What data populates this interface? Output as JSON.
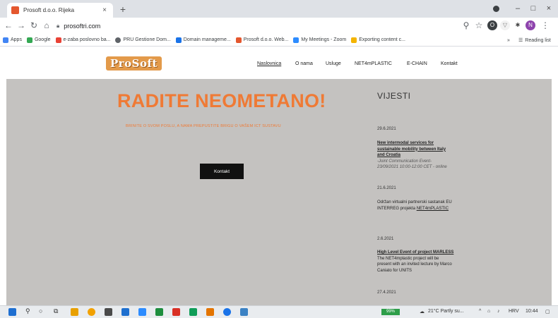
{
  "browser": {
    "tab_title": "Prosoft d.o.o. Rijeka",
    "tab_close": "×",
    "new_tab": "+",
    "url": "prosoftri.com",
    "bookmarks": [
      {
        "label": "Apps",
        "color": "#4285f4"
      },
      {
        "label": "Google",
        "color": "#34a853"
      },
      {
        "label": "e-zaba poslovno ba...",
        "color": "#e94235"
      },
      {
        "label": "PRU Gestione Dom...",
        "color": "#5f6368"
      },
      {
        "label": "Domain manageme...",
        "color": "#1a73e8"
      },
      {
        "label": "Prosoft d.o.o. Web...",
        "color": "#e4572e"
      },
      {
        "label": "My Meetings - Zoom",
        "color": "#2d8cff"
      },
      {
        "label": "Exporting content c...",
        "color": "#f4b400"
      }
    ],
    "reading_list": "Reading list",
    "window_controls": [
      "–",
      "□",
      "×"
    ]
  },
  "site": {
    "logo": "ProSoft",
    "nav": [
      "Naslovnica",
      "O nama",
      "Usluge",
      "NET4mPLASTIC",
      "E-CHAIN",
      "Kontakt"
    ],
    "active_nav": "Naslovnica",
    "hero": {
      "title": "RADITE NEOMETANO!",
      "subtitle": "BRINITE O SVOM POSLU, A NAMA PREPUSTITE BRIGU O VAŠEM ICT SUSTAVU",
      "button": "Kontakt"
    },
    "news": {
      "heading": "VIJESTI",
      "items": [
        {
          "date": "29.6.2021",
          "link_lines": [
            "New intermodal services for",
            "sustainable mobility between Italy",
            "and Croatia"
          ],
          "italic_lines": [
            "-Joint Communication Event-",
            "23/09/2021 10:00-12:00 CET - online"
          ]
        },
        {
          "date": "21.6.2021",
          "text_lines": [
            "Održan virtualni partnerski sastanak EU",
            "INTERREG projekta "
          ],
          "link": "NET4mPLASTIC"
        },
        {
          "date": "2.6.2021",
          "link_lines": [
            "High Level Event of project MARLESS"
          ],
          "text_lines": [
            "The NET4mplastic project will be",
            "present with an invited lecture by Marco",
            "Caniato for UNITS"
          ]
        },
        {
          "date": "27.4.2021"
        }
      ]
    }
  },
  "taskbar": {
    "battery": "99%",
    "weather": "21°C Partly su...",
    "lang": "HRV",
    "time": "10:44",
    "colors": {
      "start": "#1f6fd1",
      "search": "#333333",
      "apps": [
        "#4a4a4a",
        "#e8a000",
        "#0a64c2",
        "#1e6fcf",
        "#2d8cff",
        "#1e8e3e",
        "#d93025",
        "#0f9d58",
        "#e37400",
        "#1a73e8",
        "#3b82c4"
      ]
    }
  },
  "colors": {
    "accent": "#ef7a35",
    "page_bg": "#c4c2c0",
    "button_bg": "#111111"
  }
}
